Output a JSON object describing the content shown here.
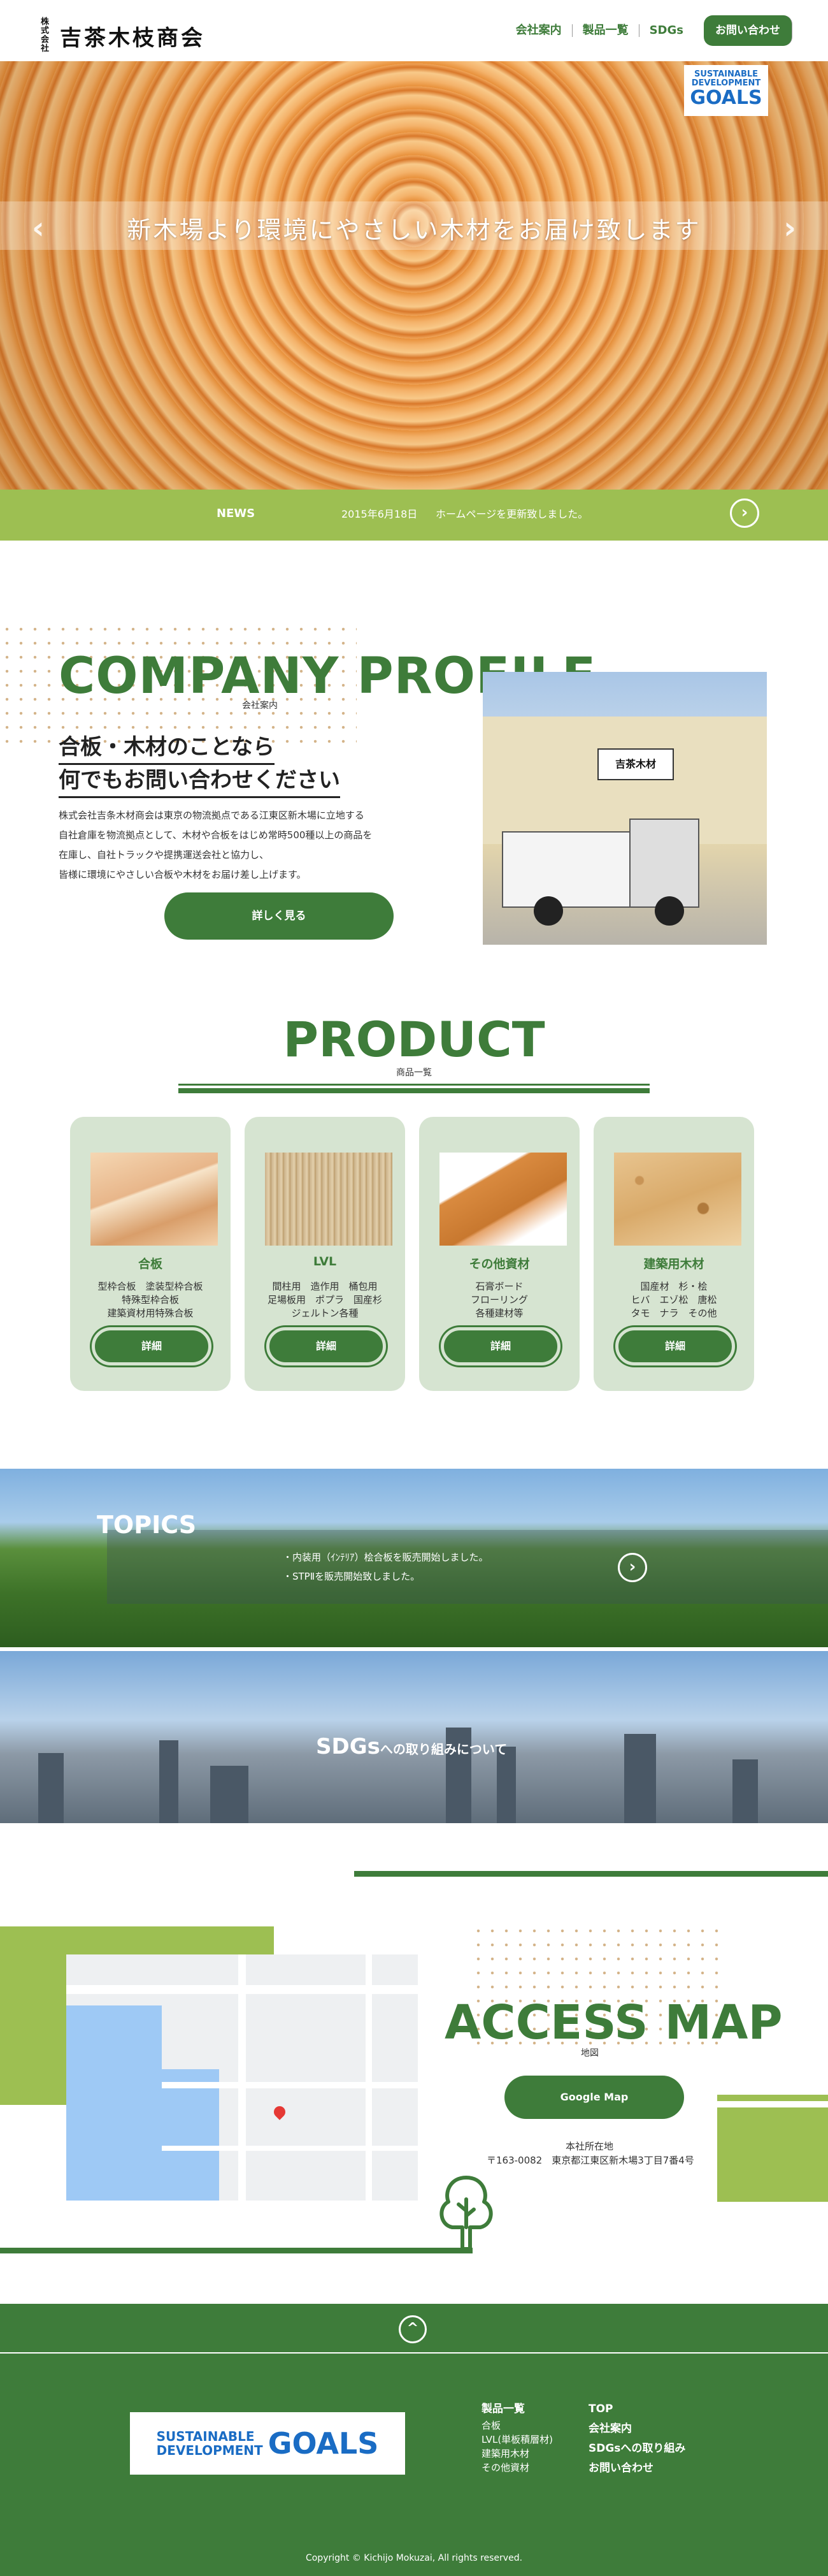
{
  "header": {
    "logo_small": "株式会社",
    "logo_main": "吉茶木枝商会",
    "nav": [
      "会社案内",
      "製品一覧",
      "SDGs"
    ],
    "contact_label": "お問い合わせ"
  },
  "hero": {
    "headline": "新木場より環境にやさしい木材をお届け致します",
    "sdg_line1": "SUSTAINABLE DEVELOPMENT",
    "sdg_line2": "GOALS",
    "prev_icon": "chevron-left-icon",
    "next_icon": "chevron-right-icon"
  },
  "news": {
    "label": "NEWS",
    "date": "2015年6月18日",
    "text": "ホームページを更新致しました。"
  },
  "company": {
    "title": "COMPANY PROFILE",
    "subtitle": "会社案内",
    "catch_1": "合板・木材のことなら",
    "catch_2": "何でもお問い合わせください",
    "body": [
      "株式会社吉条木材商会は東京の物流拠点である江東区新木場に立地する",
      "自社倉庫を物流拠点として、木材や合板をはじめ常時500種以上の商品を",
      "在庫し、自社トラックや提携運送会社と協力し、",
      "皆様に環境にやさしい合板や木材をお届け差し上げます。"
    ],
    "button": "詳しく見る",
    "photo_sign": "吉茶木材"
  },
  "product": {
    "title": "PRODUCT",
    "subtitle": "商品一覧",
    "cards": [
      {
        "name": "合板",
        "desc": [
          "型枠合板　塗装型枠合板",
          "特殊型枠合板",
          "建築資材用特殊合板"
        ],
        "button": "詳細"
      },
      {
        "name": "LVL",
        "desc": [
          "間柱用　造作用　桶包用",
          "足場板用　ポプラ　国産杉",
          "ジェルトン各種"
        ],
        "button": "詳細"
      },
      {
        "name": "その他資材",
        "desc": [
          "石膏ボード",
          "フローリング",
          "各種建材等"
        ],
        "button": "詳細"
      },
      {
        "name": "建築用木材",
        "desc": [
          "国産材　杉・桧",
          "ヒバ　エゾ松　唐松",
          "タモ　ナラ　その他"
        ],
        "button": "詳細"
      }
    ]
  },
  "topics": {
    "title": "TOPICS",
    "items": [
      "・内装用（ｲﾝﾃﾘｱ）桧合板を販売開始しました。",
      "・STPⅡを販売開始致しました。"
    ]
  },
  "sdgs": {
    "label_main": "SDGs",
    "label_rest": "への取り組みについて"
  },
  "access": {
    "title": "ACCESS MAP",
    "subtitle": "地図",
    "button": "Google Map",
    "address_label": "本社所在地",
    "address": "〒163-0082　東京都江東区新木場3丁目7番4号"
  },
  "footer": {
    "sdg_line1": "SUSTAINABLE",
    "sdg_line1b": "DEVELOPMENT",
    "sdg_line2": "GOALS",
    "col1_head": "製品一覧",
    "col1_items": [
      "合板",
      "LVL(単板積層材)",
      "建築用木材",
      "その他資材"
    ],
    "col2_items": [
      "TOP",
      "会社案内",
      "SDGsへの取り組み",
      "お問い合わせ"
    ],
    "copyright": "Copyright © Kichijo Mokuzai, All rights reserved."
  }
}
